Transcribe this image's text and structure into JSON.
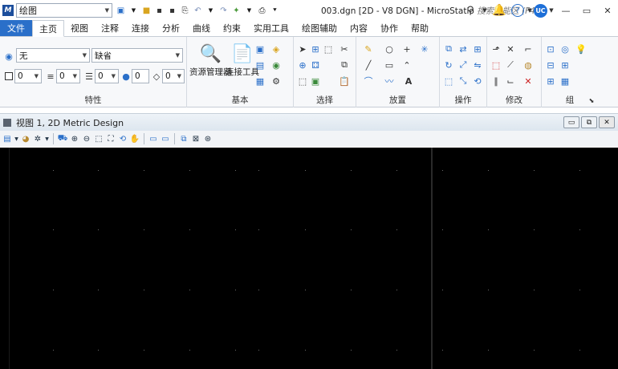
{
  "titlebar": {
    "workflow": "绘图",
    "title": "003.dgn [2D - V8 DGN] - MicroStatio",
    "search_hint": "搜索功能区 (F4)",
    "user_initials": "UC"
  },
  "tabs": [
    "文件",
    "主页",
    "视图",
    "注释",
    "连接",
    "分析",
    "曲线",
    "约束",
    "实用工具",
    "绘图辅助",
    "内容",
    "协作",
    "帮助"
  ],
  "ribbon": {
    "attributes": {
      "level": "无",
      "style": "缺省",
      "color": "0",
      "weight": "0",
      "line_style": "0",
      "transparency": "0",
      "priority": "0",
      "label": "特性"
    },
    "primary": {
      "explorer_label": "资源管理器",
      "attach_label": "连接工具",
      "label": "基本"
    },
    "group_labels": {
      "selection": "选择",
      "placement": "放置",
      "manipulate": "操作",
      "modify": "修改",
      "groups": "组"
    }
  },
  "view": {
    "title": "视图 1, 2D Metric Design"
  }
}
